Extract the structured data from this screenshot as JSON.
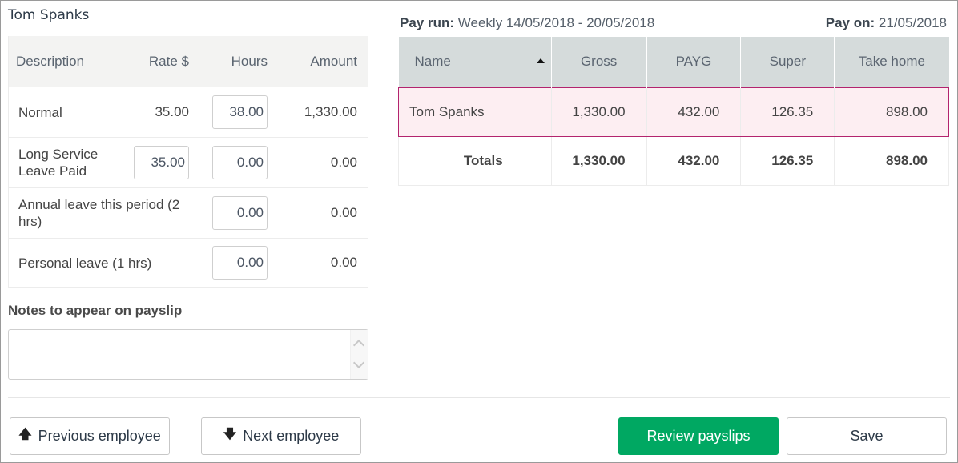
{
  "employee": {
    "name": "Tom Spanks"
  },
  "pay_lines": {
    "headers": {
      "description": "Description",
      "rate": "Rate $",
      "hours": "Hours",
      "amount": "Amount"
    },
    "rows": [
      {
        "description": "Normal",
        "rate": "35.00",
        "hours": "38.00",
        "amount": "1,330.00"
      },
      {
        "description": "Long Service Leave Paid",
        "rate": "35.00",
        "hours": "0.00",
        "amount": "0.00"
      },
      {
        "description": "Annual leave this period (2 hrs)",
        "hours": "0.00",
        "amount": "0.00"
      },
      {
        "description": "Personal leave (1 hrs)",
        "hours": "0.00",
        "amount": "0.00"
      }
    ]
  },
  "notes": {
    "label": "Notes to appear on payslip",
    "value": ""
  },
  "pay_run": {
    "label": "Pay run:",
    "value": "Weekly 14/05/2018 - 20/05/2018",
    "pay_on_label": "Pay on:",
    "pay_on_value": "21/05/2018"
  },
  "summary": {
    "headers": {
      "name": "Name",
      "gross": "Gross",
      "payg": "PAYG",
      "super": "Super",
      "take_home": "Take home"
    },
    "sort": {
      "column": "Name",
      "direction": "ascending"
    },
    "rows": [
      {
        "name": "Tom Spanks",
        "gross": "1,330.00",
        "payg": "432.00",
        "super": "126.35",
        "take_home": "898.00",
        "selected": true
      }
    ],
    "totals": {
      "label": "Totals",
      "gross": "1,330.00",
      "payg": "432.00",
      "super": "126.35",
      "take_home": "898.00"
    }
  },
  "buttons": {
    "previous": "Previous employee",
    "next": "Next employee",
    "review": "Review payslips",
    "save": "Save"
  },
  "colors": {
    "primary": "#00a862",
    "selected_row_bg": "#fdeef2",
    "selected_row_border": "#b3246e",
    "header_bg": "#d5dbdb"
  }
}
